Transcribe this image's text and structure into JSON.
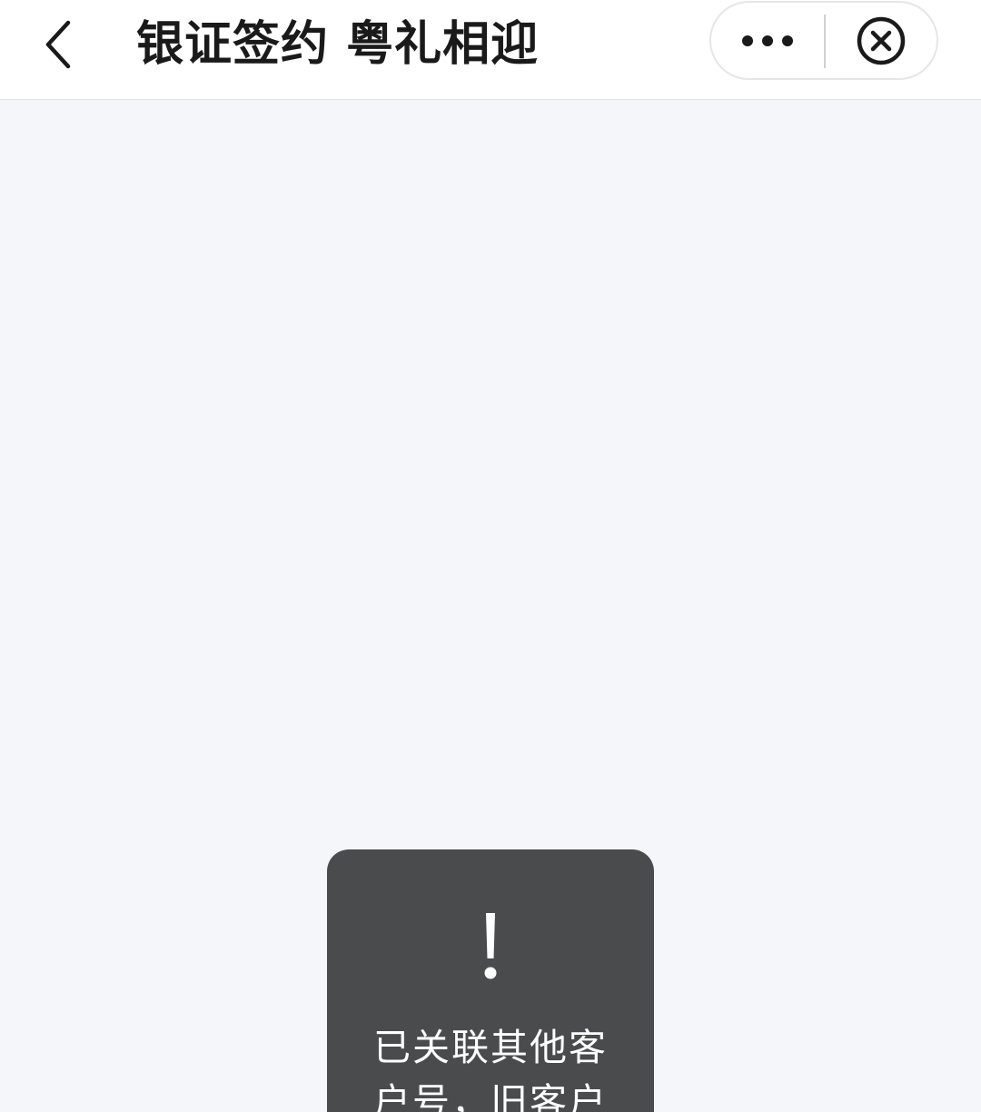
{
  "navbar": {
    "title": "银证签约 粤礼相迎",
    "back_icon": "chevron-left-icon",
    "more_icon": "more-dots-icon",
    "close_icon": "close-circle-icon"
  },
  "toast": {
    "icon": "exclamation-icon",
    "message": "已关联其他客户号，旧客户"
  },
  "colors": {
    "navbar_bg": "#ffffff",
    "page_bg": "#f5f6fa",
    "toast_bg": "#4a4b4d",
    "text_dark": "#1a1a1a",
    "text_light": "#ffffff"
  }
}
